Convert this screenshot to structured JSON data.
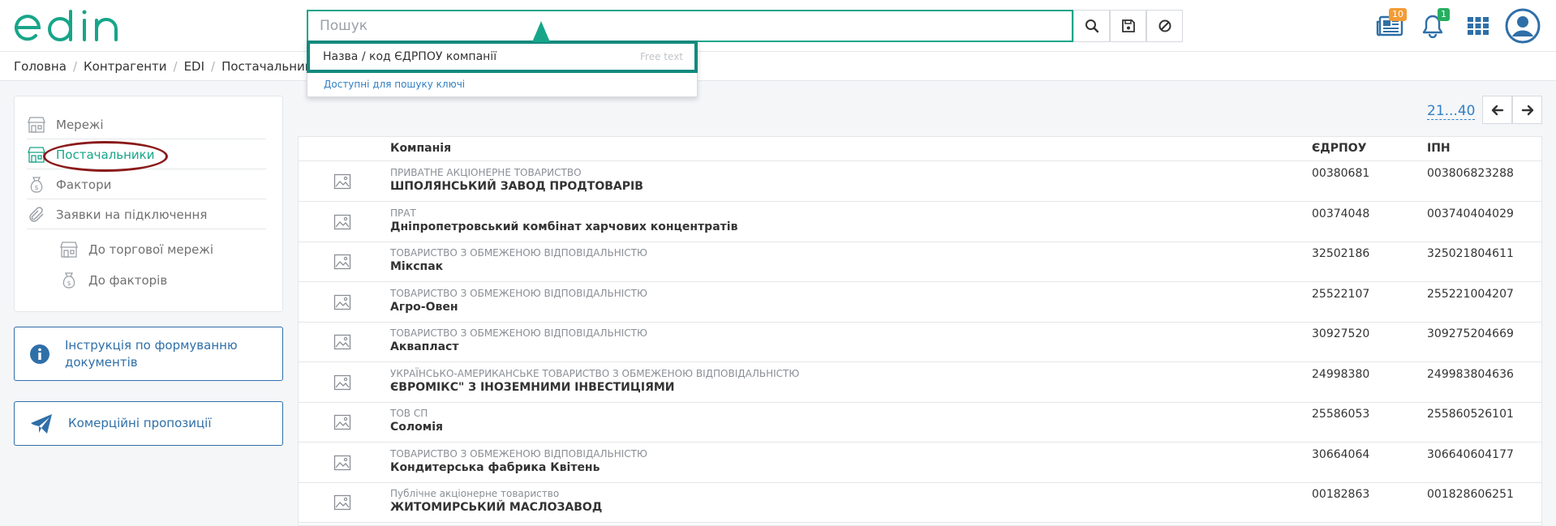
{
  "brand": {
    "logo_text": "edin",
    "accent": "#17a589"
  },
  "search": {
    "placeholder": "Пошук",
    "value": ""
  },
  "search_dropdown": {
    "item_label": "Назва / код ЄДРПОУ компанії",
    "item_hint": "Free text",
    "keys_link": "Доступні для пошуку ключі"
  },
  "header": {
    "news_badge": "10",
    "notifications_badge": "1"
  },
  "breadcrumb": [
    "Головна",
    "Контрагенти",
    "EDI",
    "Постачальники"
  ],
  "sidebar": {
    "items": [
      {
        "label": "Мережі",
        "icon": "store-icon"
      },
      {
        "label": "Постачальники",
        "icon": "store-icon"
      },
      {
        "label": "Фактори",
        "icon": "money-bag-icon"
      },
      {
        "label": "Заявки на підключення",
        "icon": "paperclip-icon"
      },
      {
        "label": "До торгової мережі",
        "icon": "store-icon"
      },
      {
        "label": "До факторів",
        "icon": "money-bag-icon"
      }
    ],
    "info_card": "Інструкція по формуванню документів",
    "offers_card": "Комерційні пропозиції"
  },
  "pagination": {
    "range": "21...40"
  },
  "table": {
    "headers": {
      "company": "Компанія",
      "edrpou": "ЄДРПОУ",
      "ipn": "ІПН"
    },
    "rows": [
      {
        "type": "ПРИВАТНЕ АКЦІОНЕРНЕ ТОВАРИСТВО",
        "name": "ШПОЛЯНСЬКИЙ ЗАВОД ПРОДТОВАРІВ",
        "edrpou": "00380681",
        "ipn": "003806823288"
      },
      {
        "type": "ПРАТ",
        "name": "Дніпропетровський комбінат харчових концентратів",
        "edrpou": "00374048",
        "ipn": "003740404029"
      },
      {
        "type": "ТОВАРИСТВО З ОБМЕЖЕНОЮ ВІДПОВІДАЛЬНІСТЮ",
        "name": "Мікспак",
        "edrpou": "32502186",
        "ipn": "325021804611"
      },
      {
        "type": "ТОВАРИСТВО З ОБМЕЖЕНОЮ ВІДПОВІДАЛЬНІСТЮ",
        "name": "Агро-Овен",
        "edrpou": "25522107",
        "ipn": "255221004207"
      },
      {
        "type": "ТОВАРИСТВО З ОБМЕЖЕНОЮ ВІДПОВІДАЛЬНІСТЮ",
        "name": "Аквапласт",
        "edrpou": "30927520",
        "ipn": "309275204669"
      },
      {
        "type": "УКРАЇНСЬКО-АМЕРИКАНСЬКЕ ТОВАРИСТВО З ОБМЕЖЕНОЮ ВІДПОВІДАЛЬНІСТЮ",
        "name": "ЄВРОМІКС\" З ІНОЗЕМНИМИ ІНВЕСТИЦІЯМИ",
        "edrpou": "24998380",
        "ipn": "249983804636"
      },
      {
        "type": "ТОВ СП",
        "name": "Соломія",
        "edrpou": "25586053",
        "ipn": "255860526101"
      },
      {
        "type": "ТОВАРИСТВО З ОБМЕЖЕНОЮ ВІДПОВІДАЛЬНІСТЮ",
        "name": "Кондитерська фабрика Квітень",
        "edrpou": "30664064",
        "ipn": "306640604177"
      },
      {
        "type": "Публічне акціонерне товариство",
        "name": "ЖИТОМИРСЬКИЙ МАСЛОЗАВОД",
        "edrpou": "00182863",
        "ipn": "001828606251"
      }
    ]
  }
}
